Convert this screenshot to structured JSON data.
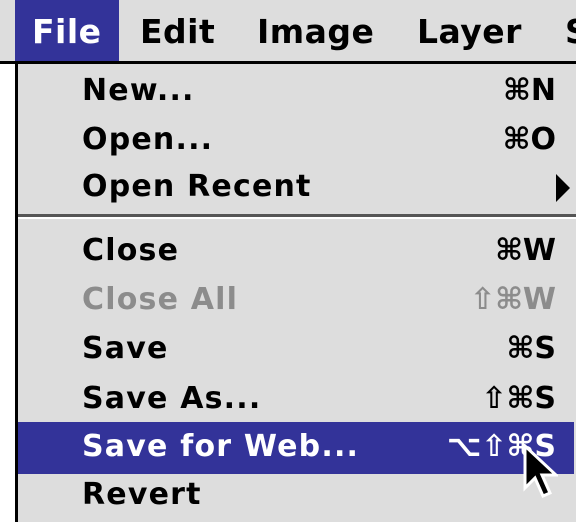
{
  "menubar": {
    "menus": [
      "File",
      "Edit",
      "Image",
      "Layer",
      "S"
    ],
    "active_menu": "File",
    "highlight_color": "#333399",
    "background_color": "#dddddd"
  },
  "file_menu": {
    "items": [
      {
        "label": "New...",
        "shortcut": "⌘N",
        "enabled": true
      },
      {
        "label": "Open...",
        "shortcut": "⌘O",
        "enabled": true
      },
      {
        "label": "Open Recent",
        "shortcut": "",
        "submenu": true,
        "enabled": true
      },
      {
        "label": "Close",
        "shortcut": "⌘W",
        "enabled": true
      },
      {
        "label": "Close All",
        "shortcut": "⇧⌘W",
        "enabled": false
      },
      {
        "label": "Save",
        "shortcut": "⌘S",
        "enabled": true
      },
      {
        "label": "Save As...",
        "shortcut": "⇧⌘S",
        "enabled": true
      },
      {
        "label": "Save for Web...",
        "shortcut": "⌥⇧⌘S",
        "enabled": true,
        "highlighted": true
      },
      {
        "label": "Revert",
        "shortcut": "",
        "enabled": true
      }
    ],
    "submenu_indicator_icon": "triangle-right-icon",
    "cursor_icon": "arrow-pointer-icon",
    "disabled_text_color": "#8c8c8c"
  }
}
